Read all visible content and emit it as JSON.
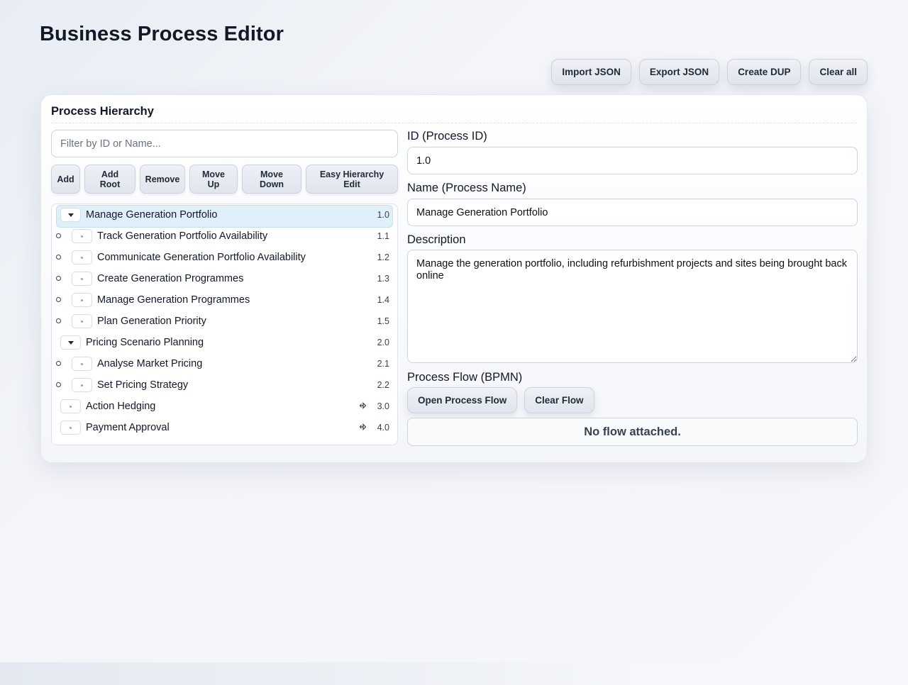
{
  "app": {
    "title": "Business Process Editor"
  },
  "toolbar": {
    "import_label": "Import JSON",
    "export_label": "Export JSON",
    "dup_label": "Create DUP",
    "clear_all_label": "Clear all"
  },
  "hierarchy": {
    "title": "Process Hierarchy",
    "filter_placeholder": "Filter by ID or Name...",
    "actions": {
      "add": "Add",
      "add_root": "Add Root",
      "remove": "Remove",
      "move_up": "Move Up",
      "move_down": "Move Down",
      "easy_edit": "Easy Hierarchy Edit"
    },
    "items": [
      {
        "id": "1.0",
        "name": "Manage Generation Portfolio",
        "level": 0,
        "expanded": true,
        "selected": true
      },
      {
        "id": "1.1",
        "name": "Track Generation Portfolio Availability",
        "level": 1
      },
      {
        "id": "1.2",
        "name": "Communicate Generation Portfolio Availability",
        "level": 1
      },
      {
        "id": "1.3",
        "name": "Create Generation Programmes",
        "level": 1
      },
      {
        "id": "1.4",
        "name": "Manage Generation Programmes",
        "level": 1
      },
      {
        "id": "1.5",
        "name": "Plan Generation Priority",
        "level": 1
      },
      {
        "id": "2.0",
        "name": "Pricing Scenario Planning",
        "level": 0,
        "expanded": true
      },
      {
        "id": "2.1",
        "name": "Analyse Market Pricing",
        "level": 1
      },
      {
        "id": "2.2",
        "name": "Set Pricing Strategy",
        "level": 1
      },
      {
        "id": "3.0",
        "name": "Action Hedging",
        "level": 0,
        "has_flow": true
      },
      {
        "id": "4.0",
        "name": "Payment Approval",
        "level": 0,
        "has_flow": true
      }
    ]
  },
  "details": {
    "id_label": "ID (Process ID)",
    "id_value": "1.0",
    "name_label": "Name (Process Name)",
    "name_value": "Manage Generation Portfolio",
    "description_label": "Description",
    "description_value": "Manage the generation portfolio, including refurbishment projects and sites being brought back online",
    "flow_label": "Process Flow (BPMN)",
    "open_flow_label": "Open Process Flow",
    "clear_flow_label": "Clear Flow",
    "flow_status": "No flow attached."
  }
}
